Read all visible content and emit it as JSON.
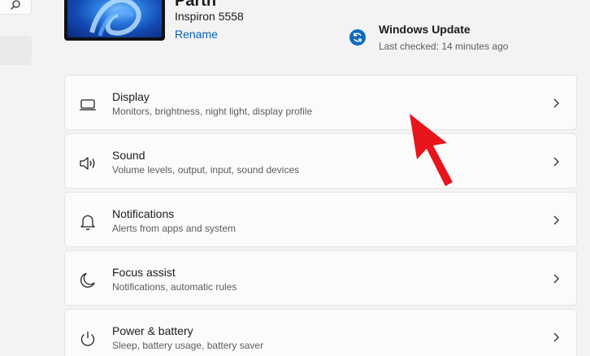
{
  "device": {
    "name": "Parth",
    "model": "Inspiron 5558",
    "rename_label": "Rename"
  },
  "windows_update": {
    "title": "Windows Update",
    "status": "Last checked: 14 minutes ago"
  },
  "settings": [
    {
      "title": "Display",
      "description": "Monitors, brightness, night light, display profile",
      "icon": "monitor-icon"
    },
    {
      "title": "Sound",
      "description": "Volume levels, output, input, sound devices",
      "icon": "speaker-icon"
    },
    {
      "title": "Notifications",
      "description": "Alerts from apps and system",
      "icon": "bell-icon"
    },
    {
      "title": "Focus assist",
      "description": "Notifications, automatic rules",
      "icon": "moon-icon"
    },
    {
      "title": "Power & battery",
      "description": "Sleep, battery usage, battery saver",
      "icon": "power-icon"
    }
  ],
  "colors": {
    "accent": "#0f6cbd",
    "link": "#0a5fb4",
    "annotation_arrow": "#e8141c"
  }
}
